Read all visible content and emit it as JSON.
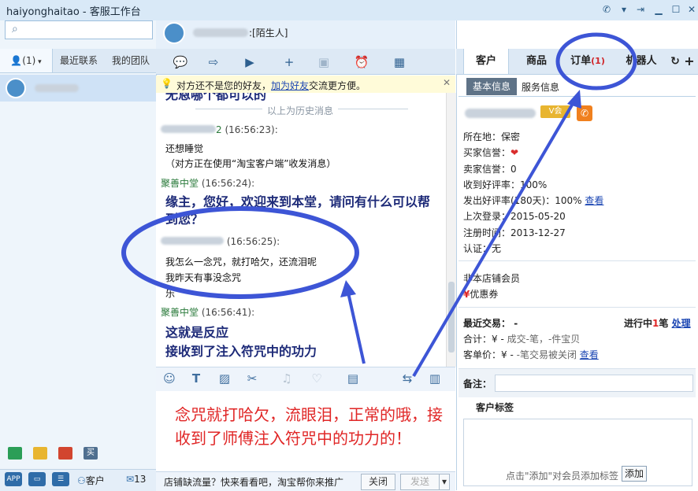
{
  "window": {
    "title": "haiyonghaitao - 客服工作台"
  },
  "left": {
    "tabs": [
      "(1)",
      "最近联系",
      "我的团队"
    ],
    "bottom_icons": [
      "APP",
      "客户",
      "13"
    ]
  },
  "chat": {
    "stranger_tag": ":[陌生人]",
    "notice": {
      "text": "对方还不是您的好友，",
      "link": "加为好友",
      "suffix": "交流更方便。"
    },
    "history_divider": "以上为历史消息",
    "messages": [
      {
        "sender": "2",
        "time": "(16:56:23):",
        "lines": [
          "还想睡觉",
          "（对方正在使用“淘宝客户端”收发消息）"
        ]
      },
      {
        "sender": "聚善中堂",
        "time": "(16:56:24):",
        "lines": [
          "缘主，您好，欢迎来到本堂，请问有什么可以帮",
          "到您？"
        ]
      },
      {
        "sender": "",
        "time": "(16:56:25):",
        "lines": [
          "我怎么一念咒，就打哈欠，还流泪呢",
          "我昨天有事没念咒",
          "乐"
        ]
      },
      {
        "sender": "聚善中堂",
        "time": "(16:56:41):",
        "lines": [
          "这就是反应",
          "接收到了注入符咒中的功力"
        ]
      }
    ],
    "partial_top": "无恩哪个都可以的",
    "overlay": "念咒就打哈欠，流眼泪，正常的哦，接收到了师傅注入符咒中的功力的！",
    "footer": {
      "promo": "店铺缺流量？快来看看吧，淘宝帮你来推广",
      "close": "关闭",
      "send": "发送"
    }
  },
  "right": {
    "tabs": [
      {
        "label": "客户"
      },
      {
        "label": "商品"
      },
      {
        "label": "订单",
        "badge": "(1)"
      },
      {
        "label": "机器人"
      }
    ],
    "subtabs": [
      "基本信息",
      "服务信息"
    ],
    "info": [
      {
        "label": "所在地：",
        "value": "保密"
      },
      {
        "label": "买家信誉：",
        "value": ""
      },
      {
        "label": "卖家信誉：",
        "value": "0"
      },
      {
        "label": "收到好评率：",
        "value": "100%"
      },
      {
        "label": "发出好评率(180天)：",
        "value": "100%",
        "link": "查看"
      },
      {
        "label": "上次登录：",
        "value": "2015-05-20"
      },
      {
        "label": "注册时间：",
        "value": "2013-12-27"
      },
      {
        "label": "认证：",
        "value": "无"
      }
    ],
    "member": "非本店铺会员",
    "coupon": "优惠券",
    "recent": {
      "label": "最近交易：",
      "value": "-",
      "status_pre": "进行中",
      "status_count": "1",
      "status_suf": "笔",
      "action": "处理"
    },
    "total": {
      "label": "合计：",
      "value": "¥ -",
      "detail": "成交-笔，-件宝贝"
    },
    "avg": {
      "label": "客单价：",
      "value": "¥ -",
      "detail": "-笔交易被关闭",
      "link": "查看"
    },
    "remark_label": "备注：",
    "tags_label": "客户标签",
    "tags_hint": "点击\"添加\"对会员添加标签",
    "add_button": "添加"
  },
  "colors": {
    "accent": "#2f6ca8",
    "annotation": "#3d55d6",
    "overlay_text": "#e02626",
    "notice_bg": "#fffbd9"
  }
}
